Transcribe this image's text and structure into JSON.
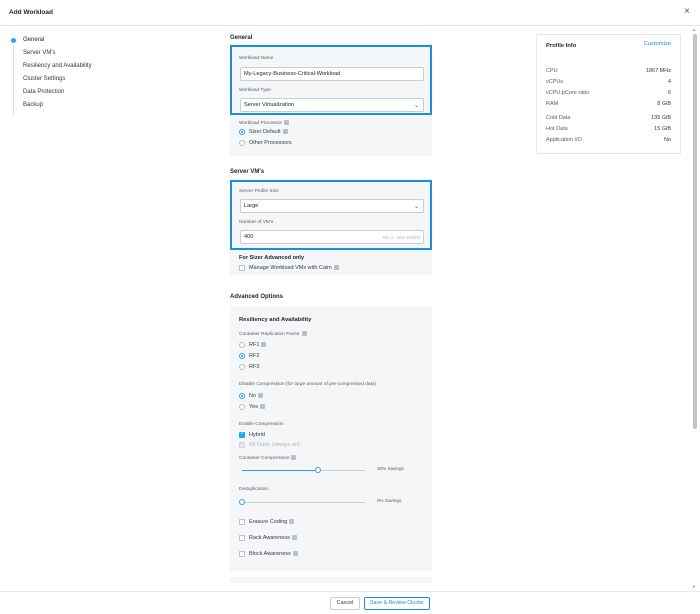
{
  "window": {
    "title": "Add Workload",
    "close_glyph": "×"
  },
  "nav": {
    "items": [
      {
        "label": "General",
        "active": true
      },
      {
        "label": "Server VM's",
        "active": false
      },
      {
        "label": "Resiliency and Availability",
        "active": false
      },
      {
        "label": "Cluster Settings",
        "active": false
      },
      {
        "label": "Data Protection",
        "active": false
      },
      {
        "label": "Backup",
        "active": false
      }
    ]
  },
  "general": {
    "heading": "General",
    "workload_name_label": "Workload Name",
    "workload_name_value": "My-Legacy-Business-Critical-Workload",
    "workload_type_label": "Workload Type",
    "workload_type_value": "Server Virtualization",
    "processor_label": "Workload Processor",
    "processor_options": [
      "Sizer Default",
      "Other Processors"
    ],
    "processor_selected": "Sizer Default"
  },
  "server_vms": {
    "heading": "Server VM's",
    "profile_size_label": "Server Profile Size",
    "profile_size_value": "Large",
    "num_vms_label": "Number of VM's",
    "num_vms_value": "400",
    "num_vms_hint": "Min 1 - Max 100000",
    "sizer_advanced_heading": "For Sizer Advanced only",
    "calm_label": "Manage Workload VMs with Calm",
    "calm_checked": false
  },
  "advanced": {
    "heading": "Advanced Options",
    "resiliency_heading": "Resiliency and Availability",
    "replication_label": "Container Replication Factor",
    "replication_options": [
      "RF1",
      "RF2",
      "RF3"
    ],
    "replication_selected": "RF2",
    "disable_compression_label": "Disable Compression (for large amount of pre-compressed data)",
    "disable_compression_options": [
      "No",
      "Yes"
    ],
    "disable_compression_selected": "No",
    "enable_compression_label": "Enable Compression",
    "hybrid_label": "Hybrid",
    "hybrid_checked": true,
    "all_flash_label": "All Flash (always on)",
    "container_compression_label": "Container Compression",
    "container_compression_savings": "30% Savings",
    "container_compression_value": 0.3,
    "dedup_label": "Deduplication",
    "dedup_savings": "0% Savings",
    "dedup_value": 0,
    "erasure_label": "Erasure Coding",
    "rack_label": "Rack Awareness",
    "block_label": "Block Awareness"
  },
  "profile_info": {
    "title": "Profile Info",
    "customize_label": "Customize",
    "rows": [
      {
        "label": "CPU",
        "value": "1867 MHz"
      },
      {
        "label": "vCPUs",
        "value": "4"
      },
      {
        "label": "vCPU:pCore ratio",
        "value": "6"
      },
      {
        "label": "RAM",
        "value": "8 GiB"
      },
      {
        "label": "Cold Data",
        "value": "135 GiB"
      },
      {
        "label": "Hot Data",
        "value": "15 GiB"
      },
      {
        "label": "Application I/O",
        "value": "No"
      }
    ]
  },
  "footer": {
    "cancel_label": "Cancel",
    "save_label": "Save & Review Cluster"
  },
  "colors": {
    "accent": "#22a5f7",
    "highlight_border": "#1b8ee0"
  }
}
